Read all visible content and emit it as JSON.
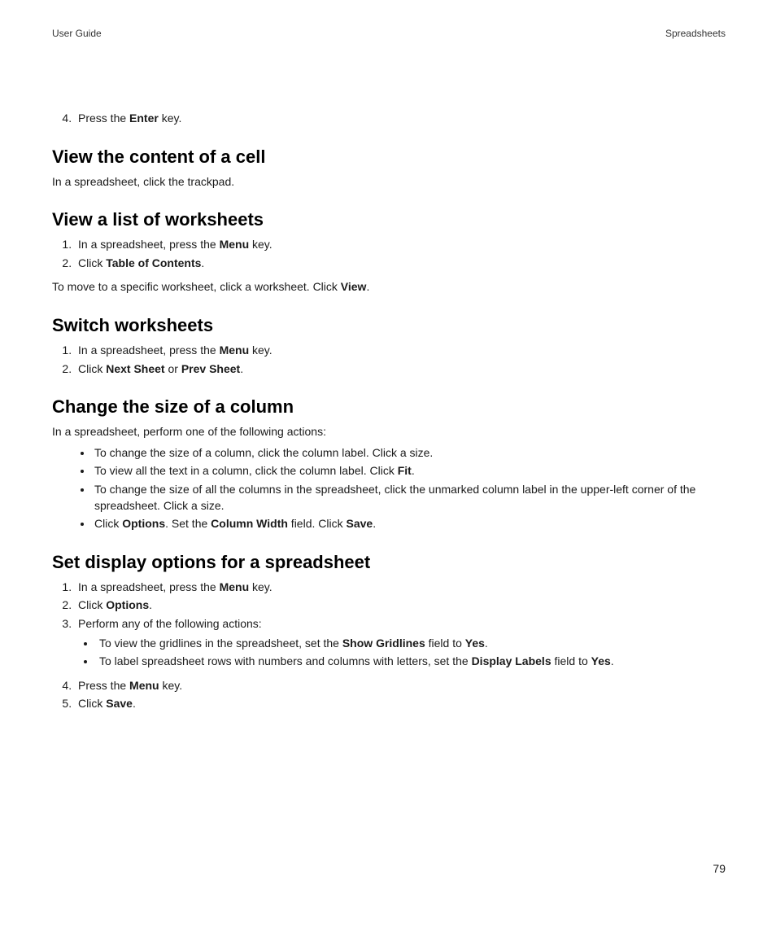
{
  "header": {
    "left": "User Guide",
    "right": "Spreadsheets"
  },
  "pageNumber": "79",
  "prevList": {
    "start": 4,
    "item": {
      "pre": "Press the ",
      "bold": "Enter",
      "post": " key."
    }
  },
  "sections": {
    "viewCell": {
      "title": "View the content of a cell",
      "body": "In a spreadsheet, click the trackpad."
    },
    "viewList": {
      "title": "View a list of worksheets",
      "steps": [
        {
          "pre": "In a spreadsheet, press the ",
          "bold": "Menu",
          "post": " key."
        },
        {
          "pre": "Click ",
          "bold": "Table of Contents",
          "post": "."
        }
      ],
      "body": {
        "pre": "To move to a specific worksheet, click a worksheet. Click ",
        "bold": "View",
        "post": "."
      }
    },
    "switch": {
      "title": "Switch worksheets",
      "steps": [
        {
          "pre": "In a spreadsheet, press the ",
          "bold": "Menu",
          "post": " key."
        },
        {
          "pre": "Click ",
          "bold": "Next Sheet",
          "mid": " or ",
          "bold2": "Prev Sheet",
          "post": "."
        }
      ]
    },
    "changeSize": {
      "title": "Change the size of a column",
      "body": "In a spreadsheet, perform one of the following actions:",
      "bullets": [
        {
          "text": "To change the size of a column, click the column label. Click a size."
        },
        {
          "pre": "To view all the text in a column, click the column label. Click ",
          "bold": "Fit",
          "post": "."
        },
        {
          "text": "To change the size of all the columns in the spreadsheet, click the unmarked column label in the upper-left corner of the spreadsheet. Click a size."
        },
        {
          "pre": "Click ",
          "bold": "Options",
          "mid": ". Set the ",
          "bold2": "Column Width",
          "mid2": " field. Click ",
          "bold3": "Save",
          "post": "."
        }
      ]
    },
    "setDisplay": {
      "title": "Set display options for a spreadsheet",
      "steps1": [
        {
          "pre": "In a spreadsheet, press the ",
          "bold": "Menu",
          "post": " key."
        },
        {
          "pre": "Click ",
          "bold": "Options",
          "post": "."
        },
        {
          "text": "Perform any of the following actions:"
        }
      ],
      "nested": [
        {
          "pre": "To view the gridlines in the spreadsheet, set the ",
          "bold": "Show Gridlines",
          "mid": " field to ",
          "bold2": "Yes",
          "post": "."
        },
        {
          "pre": "To label spreadsheet rows with numbers and columns with letters, set the ",
          "bold": "Display Labels",
          "mid": " field to ",
          "bold2": "Yes",
          "post": "."
        }
      ],
      "steps2Start": 4,
      "steps2": [
        {
          "pre": "Press the ",
          "bold": "Menu",
          "post": " key."
        },
        {
          "pre": "Click ",
          "bold": "Save",
          "post": "."
        }
      ]
    }
  }
}
